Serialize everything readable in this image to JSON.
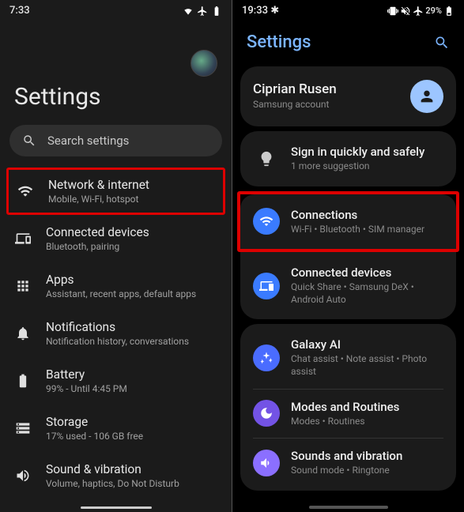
{
  "left": {
    "status": {
      "time": "7:33"
    },
    "title": "Settings",
    "search_placeholder": "Search settings",
    "items": [
      {
        "title": "Network & internet",
        "sub": "Mobile, Wi-Fi, hotspot"
      },
      {
        "title": "Connected devices",
        "sub": "Bluetooth, pairing"
      },
      {
        "title": "Apps",
        "sub": "Assistant, recent apps, default apps"
      },
      {
        "title": "Notifications",
        "sub": "Notification history, conversations"
      },
      {
        "title": "Battery",
        "sub": "99% - Until 4:45 PM"
      },
      {
        "title": "Storage",
        "sub": "17% used - 106 GB free"
      },
      {
        "title": "Sound & vibration",
        "sub": "Volume, haptics, Do Not Disturb"
      }
    ]
  },
  "right": {
    "status": {
      "time": "19:33",
      "battery": "29%"
    },
    "title": "Settings",
    "profile": {
      "name": "Ciprian Rusen",
      "sub": "Samsung account"
    },
    "signin": {
      "title": "Sign in quickly and safely",
      "sub": "1 more suggestion"
    },
    "connections": {
      "title": "Connections",
      "sub": "Wi-Fi • Bluetooth • SIM manager"
    },
    "connected": {
      "title": "Connected devices",
      "sub": "Quick Share • Samsung DeX • Android Auto"
    },
    "galaxy": {
      "title": "Galaxy AI",
      "sub": "Chat assist • Note assist • Photo assist"
    },
    "modes": {
      "title": "Modes and Routines",
      "sub": "Modes • Routines"
    },
    "sounds": {
      "title": "Sounds and vibration",
      "sub": "Sound mode • Ringtone"
    }
  }
}
